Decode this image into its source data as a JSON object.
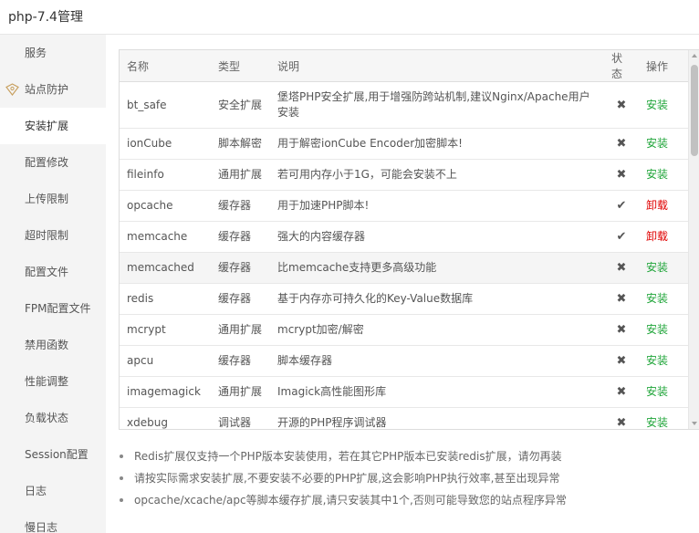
{
  "window": {
    "title": "php-7.4管理"
  },
  "sidebar": {
    "items": [
      {
        "label": "服务"
      },
      {
        "label": "站点防护"
      },
      {
        "label": "安装扩展"
      },
      {
        "label": "配置修改"
      },
      {
        "label": "上传限制"
      },
      {
        "label": "超时限制"
      },
      {
        "label": "配置文件"
      },
      {
        "label": "FPM配置文件"
      },
      {
        "label": "禁用函数"
      },
      {
        "label": "性能调整"
      },
      {
        "label": "负载状态"
      },
      {
        "label": "Session配置"
      },
      {
        "label": "日志"
      },
      {
        "label": "慢日志"
      }
    ],
    "active_index": 2,
    "shield_icon": "shield-icon"
  },
  "table": {
    "headers": {
      "name": "名称",
      "type": "类型",
      "desc": "说明",
      "status": "状态",
      "action": "操作"
    },
    "rows": [
      {
        "name": "bt_safe",
        "type": "安全扩展",
        "desc": "堡塔PHP安全扩展,用于增强防跨站机制,建议Nginx/Apache用户安装",
        "status": "✖",
        "action": "安装"
      },
      {
        "name": "ionCube",
        "type": "脚本解密",
        "desc": "用于解密ionCube Encoder加密脚本!",
        "status": "✖",
        "action": "安装"
      },
      {
        "name": "fileinfo",
        "type": "通用扩展",
        "desc": "若可用内存小于1G，可能会安装不上",
        "status": "✖",
        "action": "安装"
      },
      {
        "name": "opcache",
        "type": "缓存器",
        "desc": "用于加速PHP脚本!",
        "status": "✔",
        "action": "卸载"
      },
      {
        "name": "memcache",
        "type": "缓存器",
        "desc": "强大的内容缓存器",
        "status": "✔",
        "action": "卸载"
      },
      {
        "name": "memcached",
        "type": "缓存器",
        "desc": "比memcache支持更多高级功能",
        "status": "✖",
        "action": "安装"
      },
      {
        "name": "redis",
        "type": "缓存器",
        "desc": "基于内存亦可持久化的Key-Value数据库",
        "status": "✖",
        "action": "安装"
      },
      {
        "name": "mcrypt",
        "type": "通用扩展",
        "desc": "mcrypt加密/解密",
        "status": "✖",
        "action": "安装"
      },
      {
        "name": "apcu",
        "type": "缓存器",
        "desc": "脚本缓存器",
        "status": "✖",
        "action": "安装"
      },
      {
        "name": "imagemagick",
        "type": "通用扩展",
        "desc": "Imagick高性能图形库",
        "status": "✖",
        "action": "安装"
      },
      {
        "name": "xdebug",
        "type": "调试器",
        "desc": "开源的PHP程序调试器",
        "status": "✖",
        "action": "安装"
      }
    ]
  },
  "notes": [
    "Redis扩展仅支持一个PHP版本安装使用，若在其它PHP版本已安装redis扩展，请勿再装",
    "请按实际需求安装扩展,不要安装不必要的PHP扩展,这会影响PHP执行效率,甚至出现异常",
    "opcache/xcache/apc等脚本缓存扩展,请只安装其中1个,否则可能导致您的站点程序异常"
  ],
  "colors": {
    "install": "#20a53a",
    "uninstall": "#e00000",
    "sidebar_bg": "#f4f4f4"
  }
}
